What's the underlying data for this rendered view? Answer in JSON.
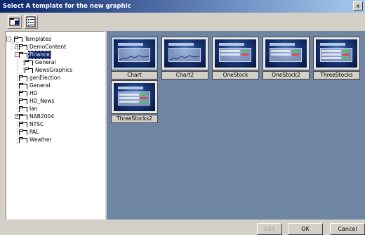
{
  "window": {
    "title": "Select A template for the new graphic",
    "close_glyph": "x"
  },
  "toolbar": {
    "buttons": [
      {
        "icon": "open-folder-icon"
      },
      {
        "icon": "list-view-icon"
      }
    ]
  },
  "tree": {
    "items": [
      {
        "label": "Templates",
        "expander": "-",
        "selected": false
      },
      {
        "label": "DemoContent",
        "expander": "+",
        "selected": false
      },
      {
        "label": "Finance",
        "expander": "-",
        "selected": true
      },
      {
        "label": "General",
        "expander": "",
        "selected": false
      },
      {
        "label": "NewsGraphics",
        "expander": "",
        "selected": false
      },
      {
        "label": "genElection",
        "expander": "",
        "selected": false
      },
      {
        "label": "General",
        "expander": "",
        "selected": false
      },
      {
        "label": "HD",
        "expander": "",
        "selected": false
      },
      {
        "label": "HD_News",
        "expander": "",
        "selected": false
      },
      {
        "label": "Ian",
        "expander": "",
        "selected": false
      },
      {
        "label": "NAB2004",
        "expander": "+",
        "selected": false
      },
      {
        "label": "NTSC",
        "expander": "",
        "selected": false
      },
      {
        "label": "PAL",
        "expander": "",
        "selected": false
      },
      {
        "label": "Weather",
        "expander": "",
        "selected": false
      }
    ]
  },
  "gallery": {
    "templates": [
      {
        "label": "Chart",
        "selected": true
      },
      {
        "label": "Chart2",
        "selected": false
      },
      {
        "label": "OneStock",
        "selected": false
      },
      {
        "label": "OneStock2",
        "selected": false
      },
      {
        "label": "ThreeStocks",
        "selected": false
      },
      {
        "label": "ThreeStocks2",
        "selected": false
      }
    ]
  },
  "buttons": {
    "edit": "Edit",
    "ok": "OK",
    "cancel": "Cancel"
  },
  "colors": {
    "gallery_bg": "#6e86a4",
    "title_bar": "#0a246a",
    "selection": "#0a246a"
  }
}
